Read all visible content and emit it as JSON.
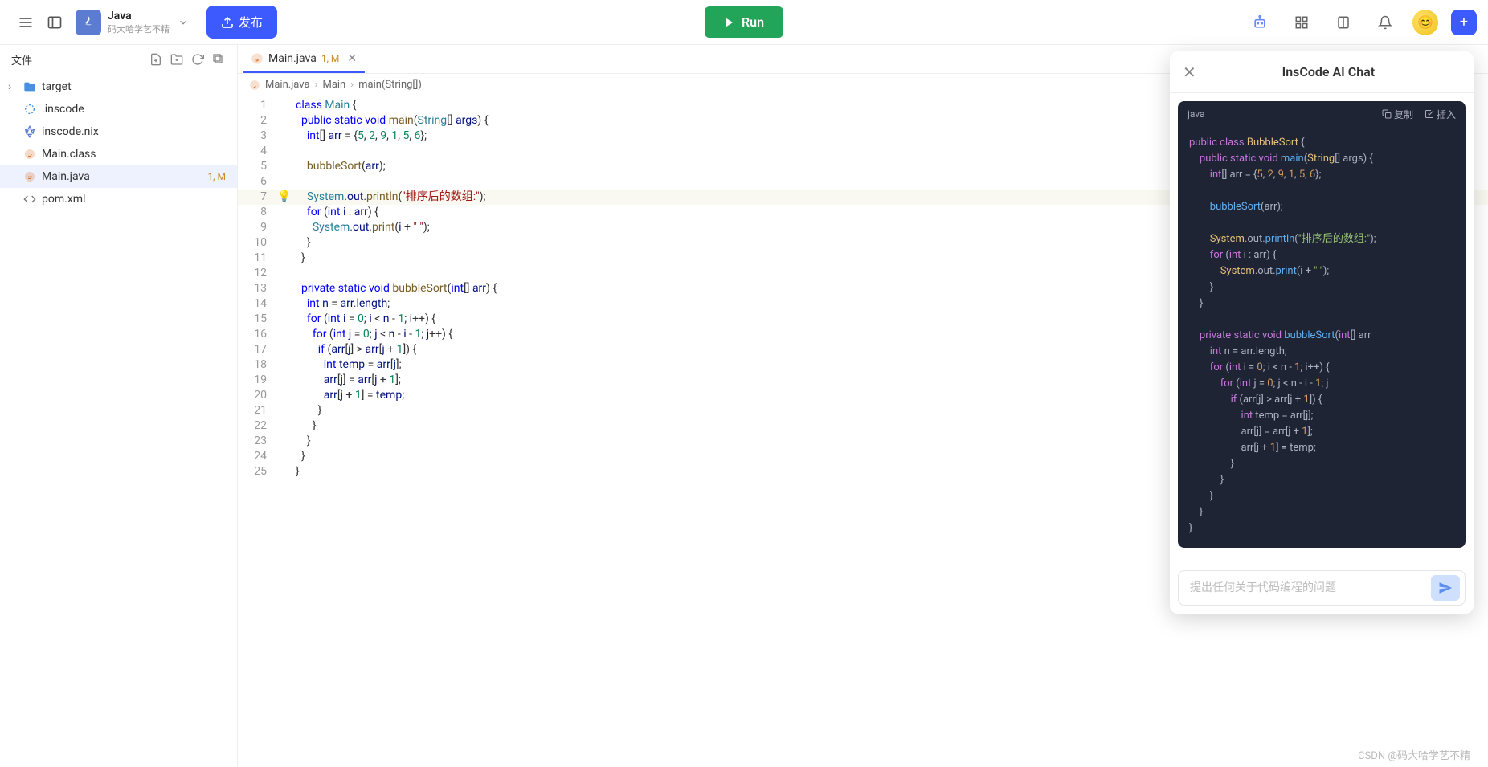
{
  "topbar": {
    "project_name": "Java",
    "project_owner": "码大哈学艺不精",
    "publish_label": "发布",
    "run_label": "Run"
  },
  "sidebar": {
    "title": "文件",
    "items": [
      {
        "name": "target",
        "kind": "folder",
        "expandable": true
      },
      {
        "name": ".inscode",
        "kind": "inscode"
      },
      {
        "name": "inscode.nix",
        "kind": "nix"
      },
      {
        "name": "Main.class",
        "kind": "class"
      },
      {
        "name": "Main.java",
        "kind": "java",
        "status": "1, M",
        "selected": true
      },
      {
        "name": "pom.xml",
        "kind": "xml"
      }
    ]
  },
  "editor": {
    "tab": {
      "label": "Main.java",
      "status": "1, M"
    },
    "breadcrumb": [
      "Main.java",
      "Main",
      "main(String[])"
    ],
    "lightbulb_line": 7,
    "highlight_line": 7,
    "lines": [
      {
        "n": 1,
        "html": "<span class='tok-kw'>class</span> <span class='tok-type'>Main</span> {"
      },
      {
        "n": 2,
        "html": "  <span class='tok-kw'>public</span> <span class='tok-kw'>static</span> <span class='tok-kw'>void</span> <span class='tok-fn'>main</span>(<span class='tok-type'>String</span>[] <span class='tok-var'>args</span>) {"
      },
      {
        "n": 3,
        "html": "    <span class='tok-kw'>int</span>[] <span class='tok-var'>arr</span> = {<span class='tok-num'>5</span>, <span class='tok-num'>2</span>, <span class='tok-num'>9</span>, <span class='tok-num'>1</span>, <span class='tok-num'>5</span>, <span class='tok-num'>6</span>};"
      },
      {
        "n": 4,
        "html": ""
      },
      {
        "n": 5,
        "html": "    <span class='tok-fn'>bubbleSort</span>(<span class='tok-var'>arr</span>);"
      },
      {
        "n": 6,
        "html": ""
      },
      {
        "n": 7,
        "html": "    <span class='tok-type'>System</span>.<span class='tok-var'>out</span>.<span class='tok-fn'>println</span>(<span class='tok-str'>\"排序后的数组:\"</span>);"
      },
      {
        "n": 8,
        "html": "    <span class='tok-kw'>for</span> (<span class='tok-kw'>int</span> <span class='tok-var'>i</span> : <span class='tok-var'>arr</span>) {"
      },
      {
        "n": 9,
        "html": "      <span class='tok-type'>System</span>.<span class='tok-var'>out</span>.<span class='tok-fn'>print</span>(<span class='tok-var'>i</span> + <span class='tok-str'>\" \"</span>);"
      },
      {
        "n": 10,
        "html": "    }"
      },
      {
        "n": 11,
        "html": "  }"
      },
      {
        "n": 12,
        "html": ""
      },
      {
        "n": 13,
        "html": "  <span class='tok-kw'>private</span> <span class='tok-kw'>static</span> <span class='tok-kw'>void</span> <span class='tok-fn'>bubbleSort</span>(<span class='tok-kw'>int</span>[] <span class='tok-var'>arr</span>) {"
      },
      {
        "n": 14,
        "html": "    <span class='tok-kw'>int</span> <span class='tok-var'>n</span> = <span class='tok-var'>arr</span>.<span class='tok-var'>length</span>;"
      },
      {
        "n": 15,
        "html": "    <span class='tok-kw'>for</span> (<span class='tok-kw'>int</span> <span class='tok-var'>i</span> = <span class='tok-num'>0</span>; <span class='tok-var'>i</span> &lt; <span class='tok-var'>n</span> - <span class='tok-num'>1</span>; <span class='tok-var'>i</span>++) {"
      },
      {
        "n": 16,
        "html": "      <span class='tok-kw'>for</span> (<span class='tok-kw'>int</span> <span class='tok-var'>j</span> = <span class='tok-num'>0</span>; <span class='tok-var'>j</span> &lt; <span class='tok-var'>n</span> - <span class='tok-var'>i</span> - <span class='tok-num'>1</span>; <span class='tok-var'>j</span>++) {"
      },
      {
        "n": 17,
        "html": "        <span class='tok-kw'>if</span> (<span class='tok-var'>arr</span>[<span class='tok-var'>j</span>] &gt; <span class='tok-var'>arr</span>[<span class='tok-var'>j</span> + <span class='tok-num'>1</span>]) {"
      },
      {
        "n": 18,
        "html": "          <span class='tok-kw'>int</span> <span class='tok-var'>temp</span> = <span class='tok-var'>arr</span>[<span class='tok-var'>j</span>];"
      },
      {
        "n": 19,
        "html": "          <span class='tok-var'>arr</span>[<span class='tok-var'>j</span>] = <span class='tok-var'>arr</span>[<span class='tok-var'>j</span> + <span class='tok-num'>1</span>];"
      },
      {
        "n": 20,
        "html": "          <span class='tok-var'>arr</span>[<span class='tok-var'>j</span> + <span class='tok-num'>1</span>] = <span class='tok-var'>temp</span>;"
      },
      {
        "n": 21,
        "html": "        }"
      },
      {
        "n": 22,
        "html": "      }"
      },
      {
        "n": 23,
        "html": "    }"
      },
      {
        "n": 24,
        "html": "  }"
      },
      {
        "n": 25,
        "html": "}"
      }
    ]
  },
  "ai": {
    "title": "InsCode AI Chat",
    "code_lang": "java",
    "copy_label": "复制",
    "insert_label": "插入",
    "placeholder": "提出任何关于代码编程的问题",
    "code_lines": [
      "<span class='ai-tok-kw'>public</span> <span class='ai-tok-kw'>class</span> <span class='ai-tok-type'>BubbleSort</span> <span class='ai-tok-plain'>{</span>",
      "    <span class='ai-tok-kw'>public</span> <span class='ai-tok-kw'>static</span> <span class='ai-tok-kw'>void</span> <span class='ai-tok-fn'>main</span><span class='ai-tok-plain'>(</span><span class='ai-tok-type'>String</span><span class='ai-tok-plain'>[] args) {</span>",
      "        <span class='ai-tok-kw'>int</span><span class='ai-tok-plain'>[] arr = {</span><span class='ai-tok-num'>5</span><span class='ai-tok-plain'>, </span><span class='ai-tok-num'>2</span><span class='ai-tok-plain'>, </span><span class='ai-tok-num'>9</span><span class='ai-tok-plain'>, </span><span class='ai-tok-num'>1</span><span class='ai-tok-plain'>, </span><span class='ai-tok-num'>5</span><span class='ai-tok-plain'>, </span><span class='ai-tok-num'>6</span><span class='ai-tok-plain'>};</span>",
      "",
      "        <span class='ai-tok-fn'>bubbleSort</span><span class='ai-tok-plain'>(arr);</span>",
      "",
      "        <span class='ai-tok-type'>System</span><span class='ai-tok-plain'>.out.</span><span class='ai-tok-fn'>println</span><span class='ai-tok-plain'>(</span><span class='ai-tok-str'>\"排序后的数组:\"</span><span class='ai-tok-plain'>);</span>",
      "        <span class='ai-tok-kw'>for</span> <span class='ai-tok-plain'>(</span><span class='ai-tok-kw'>int</span><span class='ai-tok-plain'> i : arr) {</span>",
      "            <span class='ai-tok-type'>System</span><span class='ai-tok-plain'>.out.</span><span class='ai-tok-fn'>print</span><span class='ai-tok-plain'>(i + </span><span class='ai-tok-str'>\" \"</span><span class='ai-tok-plain'>);</span>",
      "        <span class='ai-tok-plain'>}</span>",
      "    <span class='ai-tok-plain'>}</span>",
      "",
      "    <span class='ai-tok-kw'>private</span> <span class='ai-tok-kw'>static</span> <span class='ai-tok-kw'>void</span> <span class='ai-tok-fn'>bubbleSort</span><span class='ai-tok-plain'>(</span><span class='ai-tok-kw'>int</span><span class='ai-tok-plain'>[] arr</span>",
      "        <span class='ai-tok-kw'>int</span><span class='ai-tok-plain'> n = arr.length;</span>",
      "        <span class='ai-tok-kw'>for</span> <span class='ai-tok-plain'>(</span><span class='ai-tok-kw'>int</span><span class='ai-tok-plain'> i = </span><span class='ai-tok-num'>0</span><span class='ai-tok-plain'>; i &lt; n - </span><span class='ai-tok-num'>1</span><span class='ai-tok-plain'>; i++) {</span>",
      "            <span class='ai-tok-kw'>for</span> <span class='ai-tok-plain'>(</span><span class='ai-tok-kw'>int</span><span class='ai-tok-plain'> j = </span><span class='ai-tok-num'>0</span><span class='ai-tok-plain'>; j &lt; n - i - </span><span class='ai-tok-num'>1</span><span class='ai-tok-plain'>; j</span>",
      "                <span class='ai-tok-kw'>if</span> <span class='ai-tok-plain'>(arr[j] &gt; arr[j + </span><span class='ai-tok-num'>1</span><span class='ai-tok-plain'>]) {</span>",
      "                    <span class='ai-tok-kw'>int</span><span class='ai-tok-plain'> temp = arr[j];</span>",
      "                    <span class='ai-tok-plain'>arr[j] = arr[j + </span><span class='ai-tok-num'>1</span><span class='ai-tok-plain'>];</span>",
      "                    <span class='ai-tok-plain'>arr[j + </span><span class='ai-tok-num'>1</span><span class='ai-tok-plain'>] = temp;</span>",
      "                <span class='ai-tok-plain'>}</span>",
      "            <span class='ai-tok-plain'>}</span>",
      "        <span class='ai-tok-plain'>}</span>",
      "    <span class='ai-tok-plain'>}</span>",
      "<span class='ai-tok-plain'>}</span>"
    ]
  },
  "watermark": "CSDN @码大哈学艺不精"
}
